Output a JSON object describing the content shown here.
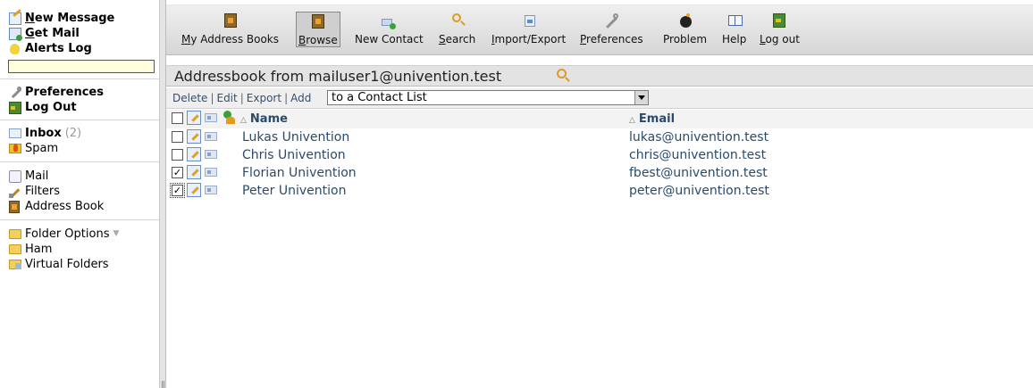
{
  "sidebar": {
    "top": [
      {
        "label": "New Message",
        "icon": "compose-icon"
      },
      {
        "label": "Get Mail",
        "icon": "get-mail-icon"
      },
      {
        "label": "Alerts Log",
        "icon": "lightbulb-icon"
      }
    ],
    "quick_search_value": "",
    "account": [
      {
        "label": "Preferences",
        "icon": "wrench-icon"
      },
      {
        "label": "Log Out",
        "icon": "exit-door-icon"
      }
    ],
    "folders": [
      {
        "label": "Inbox",
        "count": "(2)",
        "icon": "inbox-icon"
      },
      {
        "label": "Spam",
        "icon": "spam-folder-icon"
      }
    ],
    "tools": [
      {
        "label": "Mail",
        "icon": "mail-icon"
      },
      {
        "label": "Filters",
        "icon": "filter-icon"
      },
      {
        "label": "Address Book",
        "icon": "address-book-icon"
      }
    ],
    "more_folders": [
      {
        "label": "Folder Options",
        "icon": "folder-icon"
      },
      {
        "label": "Ham",
        "icon": "folder-icon"
      },
      {
        "label": "Virtual Folders",
        "icon": "virtual-folder-icon"
      }
    ]
  },
  "toolbar": [
    {
      "label": "My Address Books",
      "icon": "address-books-icon"
    },
    {
      "label": "Browse",
      "icon": "address-book-icon",
      "active": true
    },
    {
      "label": "New Contact",
      "icon": "new-contact-icon"
    },
    {
      "label": "Search",
      "icon": "search-icon"
    },
    {
      "label": "Import/Export",
      "icon": "import-export-icon"
    },
    {
      "label": "Preferences",
      "icon": "wrench-icon"
    },
    {
      "label": "Problem",
      "icon": "bomb-icon"
    },
    {
      "label": "Help",
      "icon": "book-open-icon"
    },
    {
      "label": "Log out",
      "icon": "exit-door-icon"
    }
  ],
  "addressbook": {
    "title": "Addressbook from mailuser1@univention.test",
    "actions": [
      "Delete",
      "Edit",
      "Export",
      "Add"
    ],
    "add_target": "to a Contact List",
    "columns": {
      "name": "Name",
      "email": "Email"
    },
    "contacts": [
      {
        "name": "Lukas Univention",
        "email": "lukas@univention.test",
        "checked": false
      },
      {
        "name": "Chris Univention",
        "email": "chris@univention.test",
        "checked": false
      },
      {
        "name": "Florian Univention",
        "email": "fbest@univention.test",
        "checked": true
      },
      {
        "name": "Peter Univention",
        "email": "peter@univention.test",
        "checked": true
      }
    ]
  }
}
